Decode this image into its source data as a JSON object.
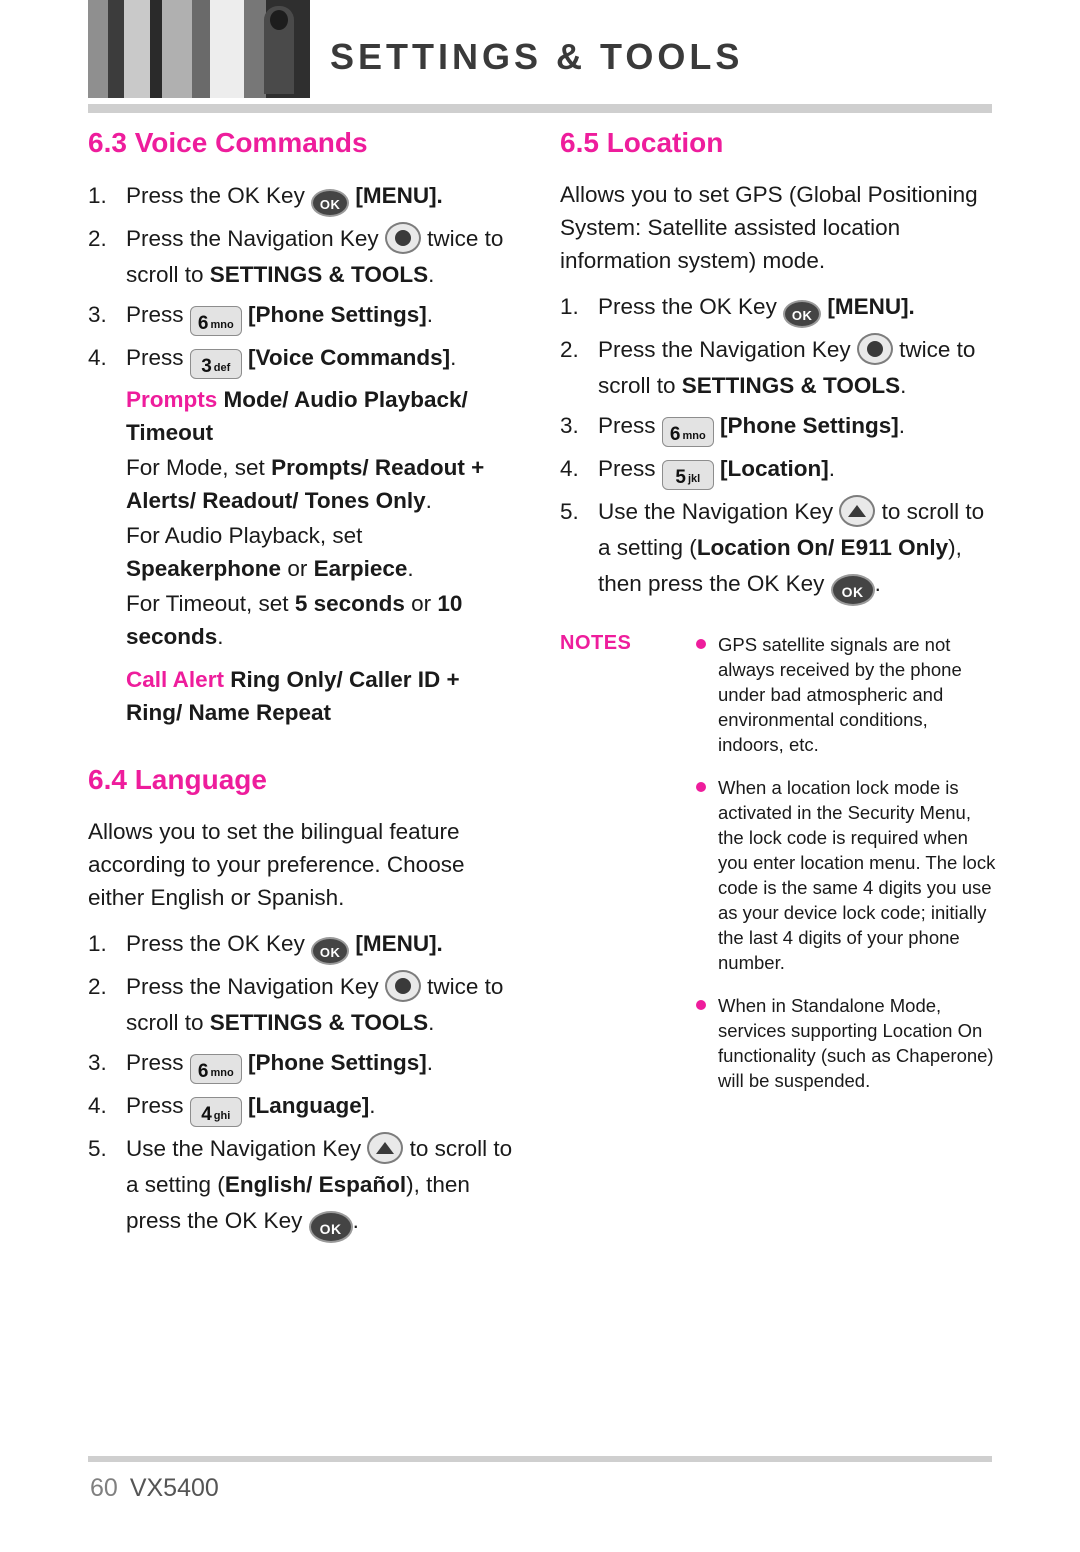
{
  "header": {
    "title": "SETTINGS & TOOLS",
    "photo_alt": "grayscale-photo"
  },
  "left_column": {
    "section_63": {
      "heading": "6.3 Voice Commands",
      "steps": [
        {
          "marker": "1.",
          "parts": [
            {
              "t": "Press the OK Key ",
              "s": "normal"
            },
            {
              "t": "icon:ok-key",
              "s": "icon"
            },
            {
              "t": " [MENU].",
              "s": "bold"
            }
          ]
        },
        {
          "marker": "2.",
          "parts": [
            {
              "t": "Press the Navigation Key ",
              "s": "normal"
            },
            {
              "t": "icon:nav-key",
              "s": "icon"
            },
            {
              "t": " twice to scroll to ",
              "s": "normal"
            },
            {
              "t": "SETTINGS & TOOLS",
              "s": "bold"
            },
            {
              "t": ".",
              "s": "normal"
            }
          ]
        },
        {
          "marker": "3.",
          "parts": [
            {
              "t": "Press ",
              "s": "normal"
            },
            {
              "t": "icon:key-6-mno",
              "s": "icon"
            },
            {
              "t": " [Phone Settings]",
              "s": "bold"
            },
            {
              "t": ".",
              "s": "normal"
            }
          ]
        },
        {
          "marker": "4.",
          "parts": [
            {
              "t": "Press ",
              "s": "normal"
            },
            {
              "t": "icon:key-3-def",
              "s": "icon"
            },
            {
              "t": " [Voice Commands]",
              "s": "bold"
            },
            {
              "t": ".",
              "s": "normal"
            }
          ]
        }
      ],
      "detail_lines": [
        "Prompts  Mode/ Audio Playback/ Timeout",
        "For Mode, set Prompts/ Readout + Alerts/ Readout/ Tones Only.",
        "For Audio Playback, set Speakerphone or Earpiece.",
        "For Timeout, set 5 seconds or 10 seconds.",
        "Call Alert  Ring Only/ Caller ID + Ring/ Name Repeat"
      ],
      "detail_pink_1": "Prompts",
      "detail_bold_1": "Mode/ Audio Playback/ Timeout",
      "detail_2_plain": "For Mode, set ",
      "detail_2_bold": "Prompts/ Readout + Alerts/ Readout/ Tones Only",
      "detail_2_end": ".",
      "detail_3_plain": "For Audio Playback, set ",
      "detail_3_bold_a": "Speakerphone",
      "detail_3_mid": " or ",
      "detail_3_bold_b": "Earpiece",
      "detail_3_end": ".",
      "detail_4_plain": "For Timeout, set ",
      "detail_4_bold_a": "5 seconds",
      "detail_4_mid": " or ",
      "detail_4_bold_b": "10 seconds",
      "detail_4_end": ".",
      "detail_pink_5": "Call Alert",
      "detail_bold_5": "Ring Only/ Caller ID + Ring/ Name Repeat"
    },
    "section_64": {
      "heading": "6.4 Language",
      "intro": "Allows you to set the bilingual feature according to your preference. Choose either English or Spanish.",
      "steps": [
        {
          "marker": "1."
        },
        {
          "marker": "2."
        },
        {
          "marker": "3."
        },
        {
          "marker": "4."
        },
        {
          "marker": "5."
        }
      ],
      "step1_a": "Press the OK Key ",
      "step1_b": " [MENU].",
      "step2_a": "Press the Navigation Key ",
      "step2_b": " twice to scroll to ",
      "step2_c": "SETTINGS & TOOLS",
      "step2_d": ".",
      "step3_a": "Press ",
      "step3_b": " [Phone Settings]",
      "step3_c": ".",
      "step4_a": "Press ",
      "step4_b": " [Language]",
      "step4_c": ".",
      "step5_a": "Use the Navigation Key ",
      "step5_b": " to scroll to a setting (",
      "step5_bold": "English/ Español",
      "step5_c": "), then press the OK Key ",
      "step5_d": "."
    }
  },
  "right_column": {
    "section_65": {
      "heading": "6.5 Location",
      "intro": "Allows you to set GPS (Global Positioning System: Satellite assisted location information system) mode.",
      "step1_a": "Press the OK Key ",
      "step1_b": " [MENU].",
      "step2_a": "Press the Navigation Key ",
      "step2_b": " twice to scroll to ",
      "step2_c": "SETTINGS & TOOLS",
      "step2_d": ".",
      "step3_a": "Press ",
      "step3_b": " [Phone Settings]",
      "step3_c": ".",
      "step4_a": "Press ",
      "step4_b": " [Location]",
      "step4_c": ".",
      "step5_a": "Use the Navigation Key ",
      "step5_b": " to scroll to a setting (",
      "step5_bold": "Location On/ E911 Only",
      "step5_c": "), then press the OK Key ",
      "step5_d": ".",
      "markers": {
        "m1": "1.",
        "m2": "2.",
        "m3": "3.",
        "m4": "4.",
        "m5": "5."
      }
    },
    "notes": {
      "label": "NOTES",
      "items": [
        "GPS satellite signals are not always received by the phone under bad atmospheric and environmental conditions, indoors, etc.",
        "When a location lock mode is activated in the Security Menu, the lock code is required when you enter location menu. The lock code is the same 4 digits you use as your device lock code; initially the last 4 digits of your phone number.",
        "When in Standalone Mode, services supporting Location On functionality (such as Chaperone) will be suspended."
      ]
    }
  },
  "keys": {
    "ok": "OK",
    "k6_digit": "6",
    "k6_letters": "mno",
    "k3_digit": "3",
    "k3_letters": "def",
    "k4_digit": "4",
    "k4_letters": "ghi",
    "k5_digit": "5",
    "k5_letters": "jkl"
  },
  "footer": {
    "page": "60",
    "model": "VX5400"
  },
  "colors": {
    "accent": "#ee1d9c",
    "rule": "#cfcfcf",
    "text": "#1a1a1a",
    "footer": "#808080"
  }
}
